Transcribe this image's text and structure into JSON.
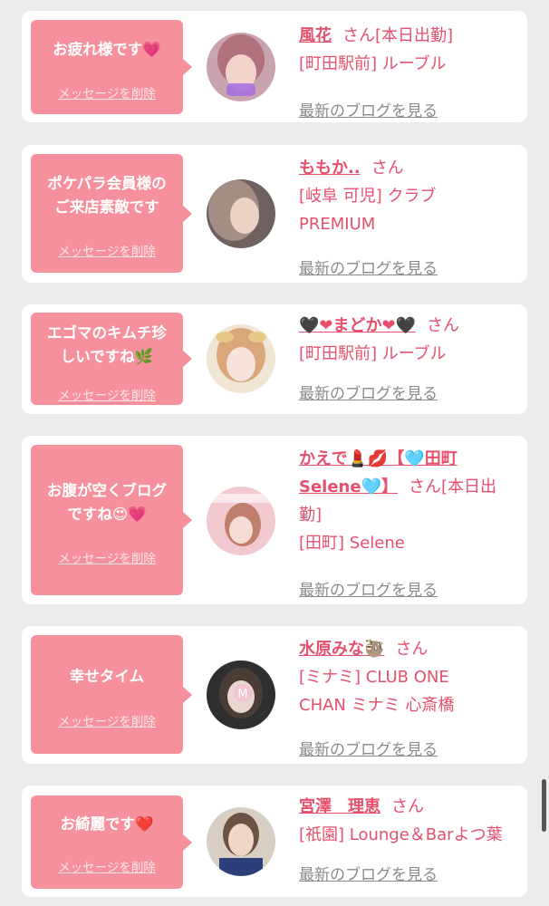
{
  "common": {
    "delete_label": "メッセージを削除",
    "san_label": "さん",
    "blog_label": "最新のブログを見る"
  },
  "cards": [
    {
      "message": [
        "お疲れ様です💗"
      ],
      "name": "風花",
      "lines": [
        "[本日出勤]",
        "[町田駅前] ルーブル"
      ]
    },
    {
      "message": [
        "ポケパラ会員様の",
        "ご来店素敵です"
      ],
      "name": "ももか..",
      "lines": [
        "[岐阜 可児] クラブ",
        "PREMIUM"
      ]
    },
    {
      "message": [
        "エゴマのキムチ珍",
        "しいですね🌿"
      ],
      "name": "🖤❤まどか❤🖤",
      "lines": [
        "[町田駅前] ルーブル"
      ]
    },
    {
      "message": [
        "お腹が空くブログ",
        "ですね😍💗"
      ],
      "name_lines": [
        "かえで💄💋【🩵田町",
        "Selene🩵】"
      ],
      "lines": [
        "[本日出",
        "勤]",
        "[田町] Selene"
      ]
    },
    {
      "message": [
        "幸せタイム"
      ],
      "name": "水原みな🦥",
      "lines": [
        "[ミナミ] CLUB ONE",
        "CHAN ミナミ 心斎橋"
      ]
    },
    {
      "message": [
        "お綺麗です❤️"
      ],
      "name": "宮澤　理恵",
      "lines": [
        "[祇園] Lounge＆Barよつ葉"
      ]
    }
  ],
  "colors": {
    "accent": "#e5506d",
    "bubble": "#f7909d",
    "link_gray": "#8a8a8a"
  }
}
